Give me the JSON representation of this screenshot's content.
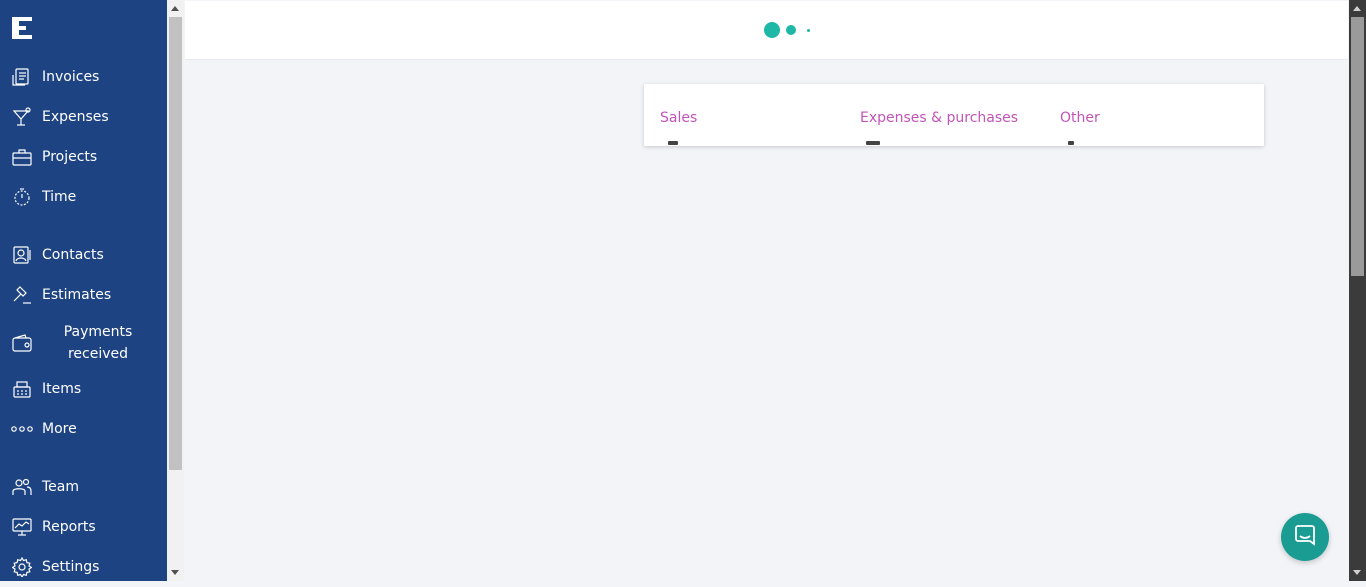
{
  "sidebar": {
    "logo_icon": "freeagent-logo-icon",
    "items": [
      {
        "label": "Invoices",
        "icon": "invoice-icon"
      },
      {
        "label": "Expenses",
        "icon": "cocktail-glass-icon"
      },
      {
        "label": "Projects",
        "icon": "briefcase-icon"
      },
      {
        "label": "Time",
        "icon": "stopwatch-icon"
      },
      {
        "label": "Contacts",
        "icon": "contact-card-icon"
      },
      {
        "label": "Estimates",
        "icon": "gavel-icon"
      },
      {
        "label": "Payments received",
        "icon": "wallet-icon"
      },
      {
        "label": "Items",
        "icon": "cash-register-icon"
      },
      {
        "label": "More",
        "icon": "more-dots-icon"
      },
      {
        "label": "Team",
        "icon": "team-icon"
      },
      {
        "label": "Reports",
        "icon": "reports-chart-icon"
      },
      {
        "label": "Settings",
        "icon": "gear-icon"
      }
    ]
  },
  "loader": {
    "icon": "loading-dots-icon"
  },
  "stats_card": {
    "columns": [
      {
        "label": "Sales"
      },
      {
        "label": "Expenses & purchases"
      },
      {
        "label": "Other"
      }
    ]
  },
  "chat": {
    "icon": "chat-bubble-icon"
  },
  "colors": {
    "sidebar_bg": "#1e4383",
    "accent_teal": "#1fb7a6",
    "label_purple": "#c254b8",
    "page_bg": "#f2f4f8"
  }
}
